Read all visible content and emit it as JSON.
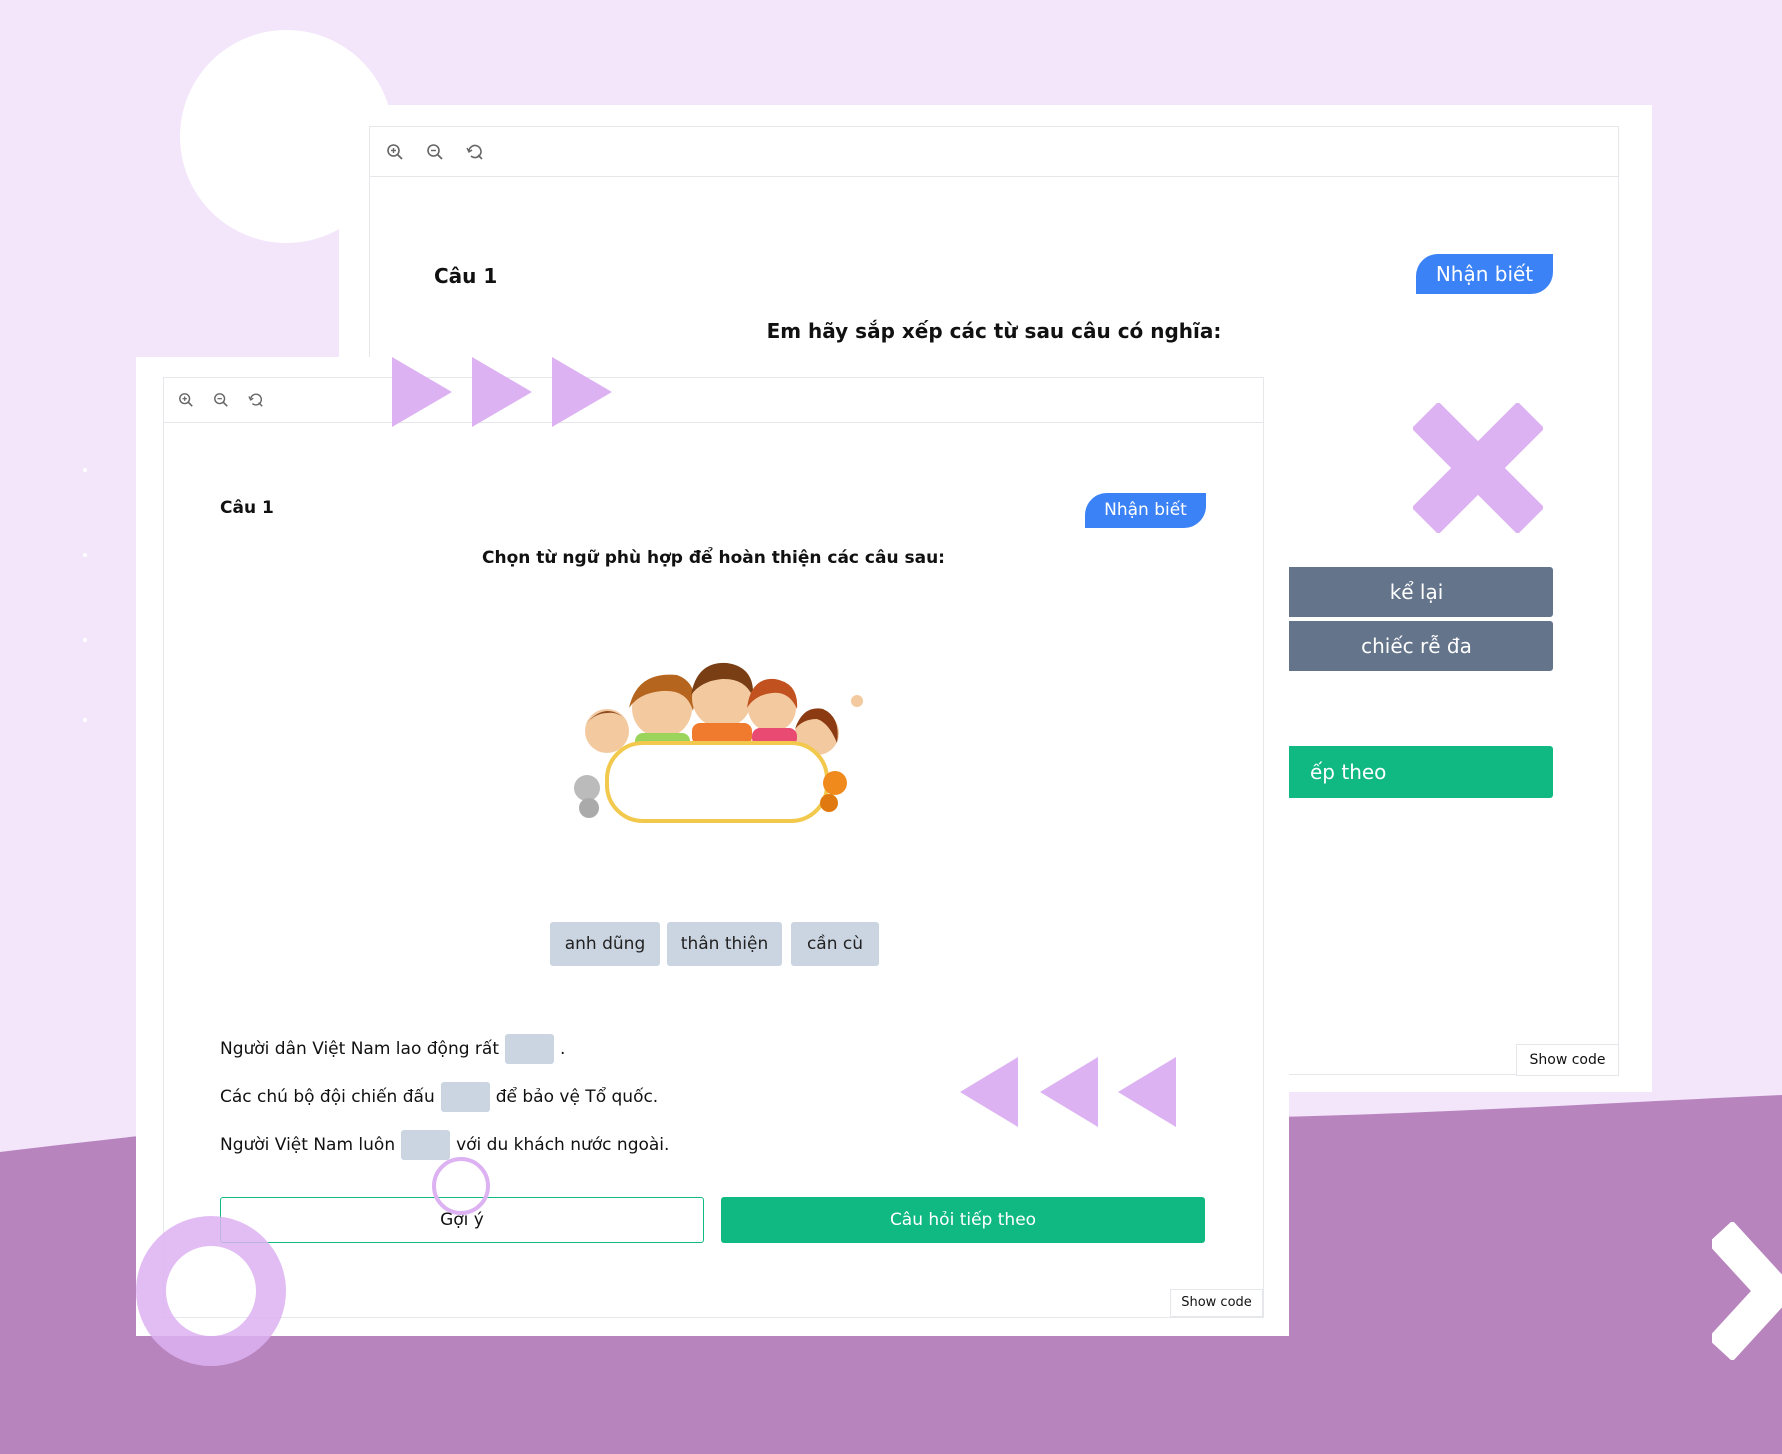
{
  "back_card": {
    "toolbar": {
      "zoom_in_icon": "zoom-in-icon",
      "zoom_out_icon": "zoom-out-icon",
      "reset_icon": "reset-icon"
    },
    "question_label": "Câu 1",
    "level_badge": "Nhận biết",
    "instruction": "Em hãy sắp xếp các từ sau câu có nghĩa:",
    "word_buttons": [
      "kể lại",
      "chiếc rễ đa"
    ],
    "next_button_partial": "ếp theo",
    "show_code": "Show code"
  },
  "front_card": {
    "toolbar": {
      "zoom_in_icon": "zoom-in-icon",
      "zoom_out_icon": "zoom-out-icon",
      "reset_icon": "reset-icon"
    },
    "question_label": "Câu 1",
    "level_badge": "Nhận biết",
    "instruction": "Chọn từ ngữ phù hợp để hoàn thiện các câu sau:",
    "illustration": "children-holding-blank-sign",
    "word_chips": [
      "anh dũng",
      "thân thiện",
      "cần cù"
    ],
    "sentences": [
      {
        "before": "Người dân Việt Nam lao động rất",
        "after": "."
      },
      {
        "before": "Các chú bộ đội chiến đấu",
        "after": "để bảo vệ Tổ quốc."
      },
      {
        "before": "Người Việt Nam luôn",
        "after": "với du khách nước ngoài."
      }
    ],
    "hint_button": "Gợi ý",
    "next_button": "Câu hỏi tiếp theo",
    "show_code": "Show code"
  },
  "colors": {
    "background": "#f3e6fb",
    "wave": "#b884be",
    "decoration": "#dcb2f2",
    "badge_blue": "#3b82f6",
    "primary_green": "#10b981",
    "word_slate": "#64748b",
    "chip_gray": "#cbd5e1"
  }
}
